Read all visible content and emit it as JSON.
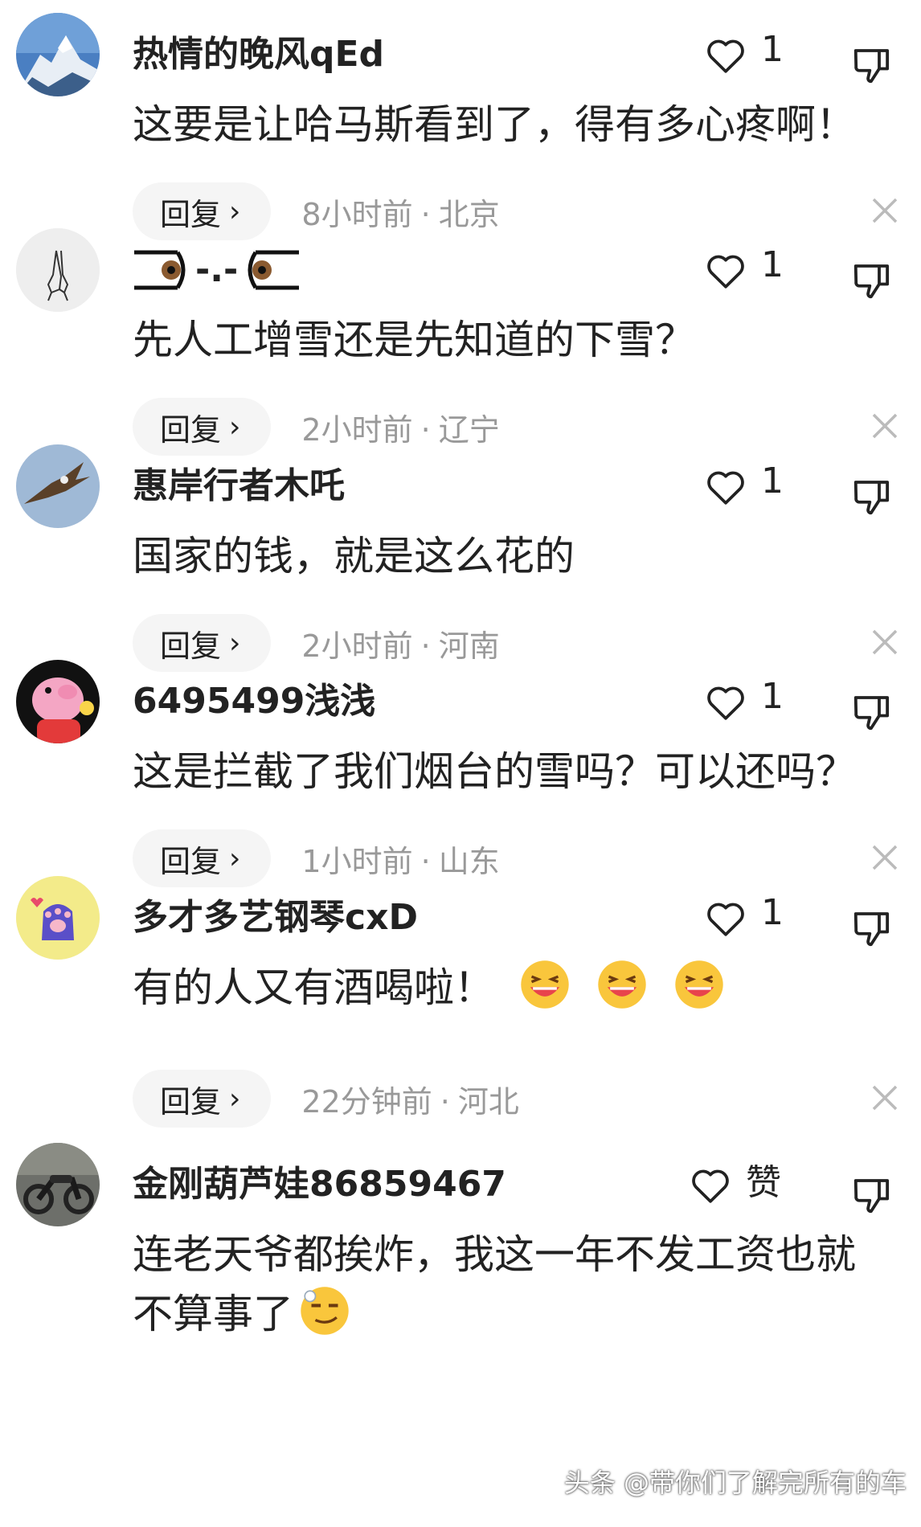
{
  "comments": [
    {
      "username": "热情的晚风qEd",
      "text": "这要是让哈马斯看到了，得有多心疼啊！",
      "likes": "1",
      "reply_label": "回复",
      "time": "8小时前",
      "location": "北京",
      "avatar": "mountain-avatar"
    },
    {
      "username": "-.-",
      "text": "先人工增雪还是先知道的下雪？",
      "likes": "1",
      "reply_label": "回复",
      "time": "2小时前",
      "location": "辽宁",
      "avatar": "praying-hands-avatar"
    },
    {
      "username": "惠岸行者木吒",
      "text": "国家的钱，就是这么花的",
      "likes": "1",
      "reply_label": "回复",
      "time": "2小时前",
      "location": "河南",
      "avatar": "eagle-avatar"
    },
    {
      "username": "6495499浅浅",
      "text": "这是拦截了我们烟台的雪吗？可以还吗？",
      "likes": "1",
      "reply_label": "回复",
      "time": "1小时前",
      "location": "山东",
      "avatar": "peppa-pig-avatar"
    },
    {
      "username": "多才多艺钢琴cxD",
      "text": "有的人又有酒喝啦！",
      "likes": "1",
      "reply_label": "回复",
      "time": "22分钟前",
      "location": "河北",
      "avatar": "cat-paw-avatar",
      "emojis": [
        "laughing-emoji",
        "laughing-emoji",
        "laughing-emoji"
      ]
    },
    {
      "username": "金刚葫芦娃86859467",
      "text": "连老天爷都挨炸，我这一年不发工资也就不算事了",
      "likes": "赞",
      "avatar": "motorcycle-avatar",
      "emojis": [
        "smirk-emoji"
      ]
    }
  ],
  "watermark": "头条 @带你们了解完所有的车",
  "dot": "·",
  "colors": {
    "text": "#222222",
    "meta": "#999999",
    "reply_bg": "#f5f5f5"
  }
}
